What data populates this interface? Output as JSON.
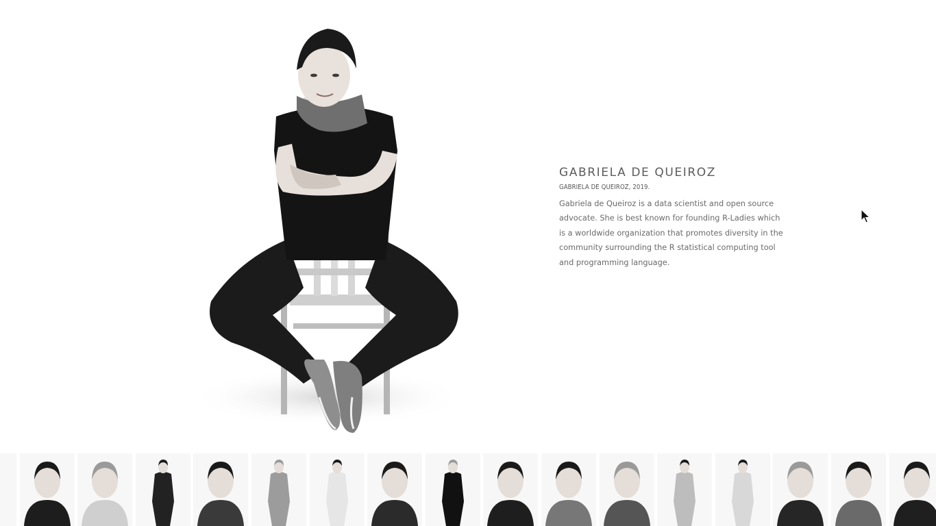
{
  "artwork": {
    "title": "GABRIELA DE QUEIROZ",
    "subtitle": "GABRIELA DE QUEIROZ, 2019.",
    "description": "Gabriela de Queiroz is a data scientist and open source advocate. She is best known for founding R-Ladies which is a worldwide organization that promotes diversity in the community surrounding the R statistical computing tool and programming language."
  },
  "thumbnails": [
    {
      "name": "portrait-thumb-01",
      "style": "standing-dark"
    },
    {
      "name": "portrait-thumb-02",
      "style": "closeup-dark-hair"
    },
    {
      "name": "portrait-thumb-03",
      "style": "closeup-older-man"
    },
    {
      "name": "portrait-thumb-04",
      "style": "standing-man-dark"
    },
    {
      "name": "portrait-thumb-05",
      "style": "closeup-woman-long-hair"
    },
    {
      "name": "portrait-thumb-06",
      "style": "seated-man-shirt"
    },
    {
      "name": "portrait-thumb-07",
      "style": "woman-white-jacket"
    },
    {
      "name": "portrait-thumb-08",
      "style": "closeup-man-glasses"
    },
    {
      "name": "portrait-thumb-09",
      "style": "seated-chair-current"
    },
    {
      "name": "portrait-thumb-10",
      "style": "closeup-woman-scarf"
    },
    {
      "name": "portrait-thumb-11",
      "style": "bearded-man-pattern"
    },
    {
      "name": "portrait-thumb-12",
      "style": "bearded-man-glasses"
    },
    {
      "name": "portrait-thumb-13",
      "style": "woman-standing-pose"
    },
    {
      "name": "portrait-thumb-14",
      "style": "woman-seated-light"
    },
    {
      "name": "portrait-thumb-15",
      "style": "closeup-man-hand"
    },
    {
      "name": "portrait-thumb-16",
      "style": "closeup-man-glasses-2"
    },
    {
      "name": "portrait-thumb-17",
      "style": "closeup-man-partial"
    }
  ]
}
